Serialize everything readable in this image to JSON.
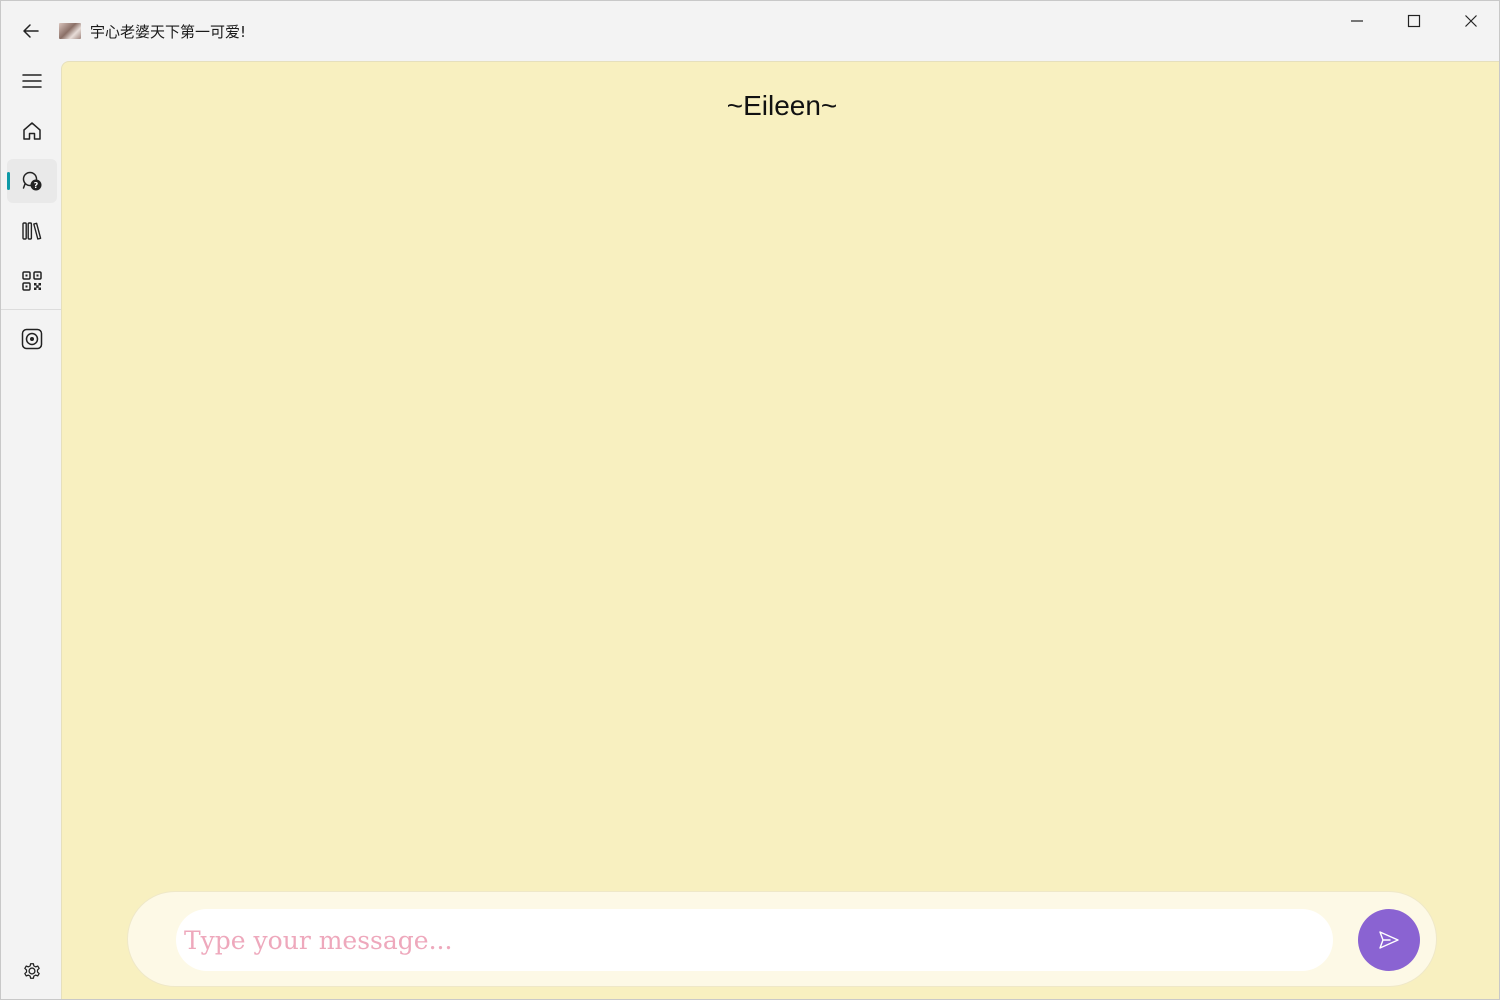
{
  "window": {
    "title": "宇心老婆天下第一可爱!",
    "controls": [
      "minimize-icon",
      "maximize-icon",
      "close-icon"
    ]
  },
  "nav": {
    "items": [
      {
        "name": "hamburger-menu",
        "icon": "hamburger-icon"
      },
      {
        "name": "home",
        "icon": "home-icon"
      },
      {
        "name": "chat",
        "icon": "chat-help-icon",
        "selected": true
      },
      {
        "name": "library",
        "icon": "library-icon"
      },
      {
        "name": "qr-code",
        "icon": "qr-code-icon"
      },
      {
        "name": "media",
        "icon": "media-target-icon"
      }
    ],
    "footer": {
      "name": "settings",
      "icon": "gear-icon"
    },
    "accent_color": "#0e9aa7"
  },
  "chat": {
    "title": "~Eileen~",
    "input_placeholder": "Type your message...",
    "input_value": "",
    "send_icon": "send-icon",
    "colors": {
      "background": "#f8f0c0",
      "send_button": "#8a63d2",
      "placeholder": "#eea8bc"
    }
  }
}
